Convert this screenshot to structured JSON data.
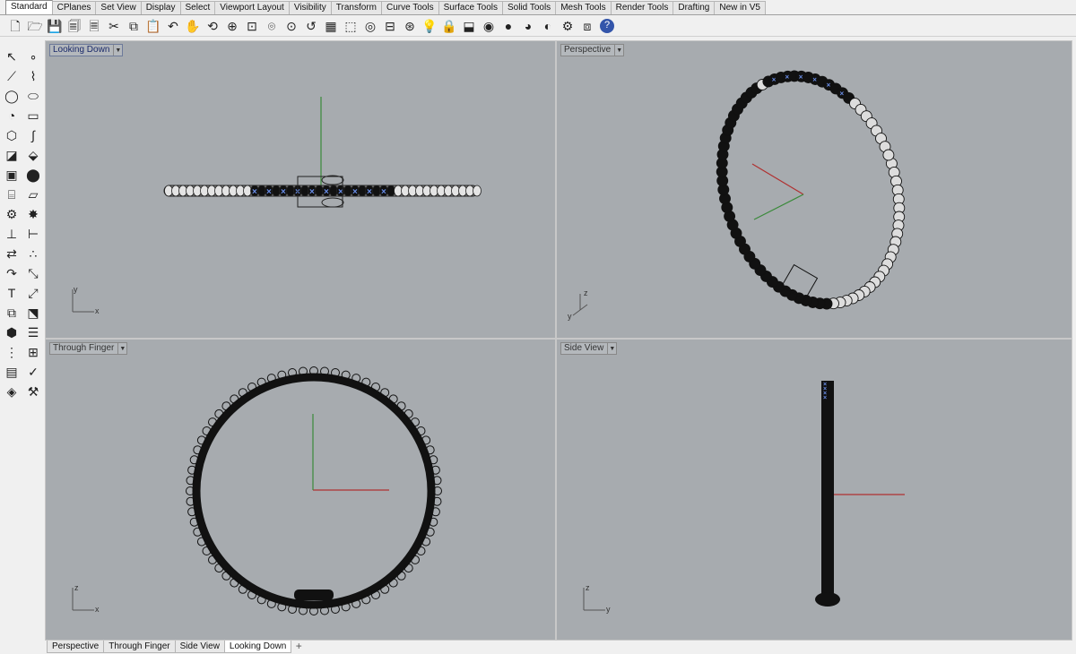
{
  "tabs": [
    "Standard",
    "CPlanes",
    "Set View",
    "Display",
    "Select",
    "Viewport Layout",
    "Visibility",
    "Transform",
    "Curve Tools",
    "Surface Tools",
    "Solid Tools",
    "Mesh Tools",
    "Render Tools",
    "Drafting",
    "New in V5"
  ],
  "active_tab_index": 0,
  "toolbar_icons": [
    "new-file-icon",
    "open-file-icon",
    "save-icon",
    "print-icon",
    "import-icon",
    "cut-icon",
    "copy-icon",
    "paste-icon",
    "undo-icon",
    "pan-hand-icon",
    "rotate-view-icon",
    "zoom-dynamic-icon",
    "zoom-window-icon",
    "zoom-extents-icon",
    "zoom-selected-icon",
    "undo-view-icon",
    "four-viewports-icon",
    "set-cplane-icon",
    "ortho-icon",
    "named-views-icon",
    "osnap-icon",
    "light-icon",
    "lock-icon",
    "hide-icon",
    "color-wheel-icon",
    "render-sphere-icon",
    "material-sphere-icon",
    "render-preview-icon",
    "options-icon",
    "layers-icon",
    "help-icon"
  ],
  "toolbar_glyphs": [
    "🗋",
    "🗁",
    "💾",
    "🗐",
    "🗏",
    "✂",
    "⧉",
    "📋",
    "↶",
    "✋",
    "⟲",
    "⊕",
    "⊡",
    "⌾",
    "⊙",
    "↺",
    "▦",
    "⬚",
    "◎",
    "⊟",
    "⊛",
    "💡",
    "🔒",
    "⬓",
    "◉",
    "●",
    "◕",
    "◐",
    "⚙",
    "⧈",
    "?"
  ],
  "left_tools": [
    {
      "name": "select-icon",
      "glyph": "↖"
    },
    {
      "name": "point-icon",
      "glyph": "∘"
    },
    {
      "name": "polyline-icon",
      "glyph": "⟋"
    },
    {
      "name": "curve-icon",
      "glyph": "⌇"
    },
    {
      "name": "circle-icon",
      "glyph": "◯"
    },
    {
      "name": "ellipse-icon",
      "glyph": "⬭"
    },
    {
      "name": "arc-icon",
      "glyph": "◔"
    },
    {
      "name": "rectangle-icon",
      "glyph": "▭"
    },
    {
      "name": "polygon-icon",
      "glyph": "⬡"
    },
    {
      "name": "freeform-curve-icon",
      "glyph": "∫"
    },
    {
      "name": "surface-icon",
      "glyph": "◪"
    },
    {
      "name": "extrude-surface-icon",
      "glyph": "⬙"
    },
    {
      "name": "box-icon",
      "glyph": "▣"
    },
    {
      "name": "sphere-icon",
      "glyph": "⬤"
    },
    {
      "name": "cylinder-icon",
      "glyph": "⌸"
    },
    {
      "name": "plane-icon",
      "glyph": "▱"
    },
    {
      "name": "boolean-icon",
      "glyph": "⚙"
    },
    {
      "name": "explode-icon",
      "glyph": "✸"
    },
    {
      "name": "fillet-icon",
      "glyph": "⊥"
    },
    {
      "name": "trim-icon",
      "glyph": "⊢"
    },
    {
      "name": "move-icon",
      "glyph": "⇄"
    },
    {
      "name": "array-icon",
      "glyph": "∴"
    },
    {
      "name": "offset-icon",
      "glyph": "↷"
    },
    {
      "name": "scale-icon",
      "glyph": "⤡"
    },
    {
      "name": "text-icon",
      "glyph": "T"
    },
    {
      "name": "dimension-icon",
      "glyph": "⤢"
    },
    {
      "name": "group-icon",
      "glyph": "⧉"
    },
    {
      "name": "block-icon",
      "glyph": "⬔"
    },
    {
      "name": "mesh-icon",
      "glyph": "⬢"
    },
    {
      "name": "render-icon",
      "glyph": "☰"
    },
    {
      "name": "grid-array-icon",
      "glyph": "⋮"
    },
    {
      "name": "analyze-icon",
      "glyph": "⊞"
    },
    {
      "name": "properties-icon",
      "glyph": "▤"
    },
    {
      "name": "check-icon",
      "glyph": "✓"
    },
    {
      "name": "solid-tools-icon",
      "glyph": "◈"
    },
    {
      "name": "wrench-icon",
      "glyph": "⚒"
    }
  ],
  "viewports": {
    "top_left": {
      "title": "Looking Down",
      "axis_a": "y",
      "axis_b": "x"
    },
    "top_right": {
      "title": "Perspective",
      "axis_a": "z",
      "axis_b": "y"
    },
    "bottom_left": {
      "title": "Through Finger",
      "axis_a": "z",
      "axis_b": "x"
    },
    "bottom_right": {
      "title": "Side View",
      "axis_a": "z",
      "axis_b": "y"
    }
  },
  "active_viewport": "top_left",
  "bottom_tabs": [
    "Perspective",
    "Through Finger",
    "Side View",
    "Looking Down"
  ],
  "active_bottom_tab_index": 3,
  "add_tab_glyph": "+",
  "colors": {
    "viewport_bg": "#a7abaf",
    "x_axis": "#b03030",
    "y_axis": "#3a8a3a",
    "gem_highlight": "#6a8ee8"
  }
}
